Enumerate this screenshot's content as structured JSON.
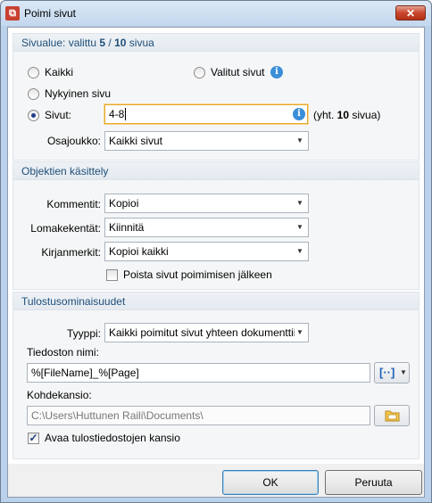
{
  "window": {
    "title": "Poimi sivut"
  },
  "page_range": {
    "header_prefix": "Sivualue: valittu ",
    "selected": "5",
    "separator": " / ",
    "total": "10",
    "header_suffix": " sivua",
    "option_all": "Kaikki",
    "option_selected_pages": "Valitut sivut",
    "option_current_page": "Nykyinen sivu",
    "option_pages": "Sivut:",
    "pages_value": "4-8",
    "total_note_prefix": "(yht. ",
    "total_note_count": "10",
    "total_note_suffix": " sivua)",
    "subset_label": "Osajoukko:",
    "subset_value": "Kaikki sivut",
    "selected_option": "pages"
  },
  "object_handling": {
    "header": "Objektien käsittely",
    "comments_label": "Kommentit:",
    "comments_value": "Kopioi",
    "forms_label": "Lomakekentät:",
    "forms_value": "Kiinnitä",
    "bookmarks_label": "Kirjanmerkit:",
    "bookmarks_value": "Kopioi kaikki",
    "delete_after_label": "Poista sivut poimimisen jälkeen",
    "delete_after_checked": false
  },
  "output": {
    "header": "Tulostusominaisuudet",
    "type_label": "Tyyppi:",
    "type_value": "Kaikki poimitut sivut yhteen dokumenttiin",
    "filename_label": "Tiedoston nimi:",
    "filename_value": "%[FileName]_%[Page]",
    "folder_label": "Kohdekansio:",
    "folder_value": "C:\\Users\\Huttunen Raili\\Documents\\",
    "open_folder_label": "Avaa tulostiedostojen kansio",
    "open_folder_checked": true
  },
  "buttons": {
    "ok": "OK",
    "cancel": "Peruuta"
  },
  "icons": {
    "app": "pdf-app-icon",
    "close": "close-icon",
    "info": "info-icon",
    "macro": "macro-brackets-icon",
    "folder": "folder-browse-icon",
    "check": "checkmark-icon"
  },
  "colors": {
    "section_title": "#1e4e79",
    "focus_border": "#e6a72a",
    "close_red": "#c8452c",
    "info_blue": "#3b8ed8"
  }
}
